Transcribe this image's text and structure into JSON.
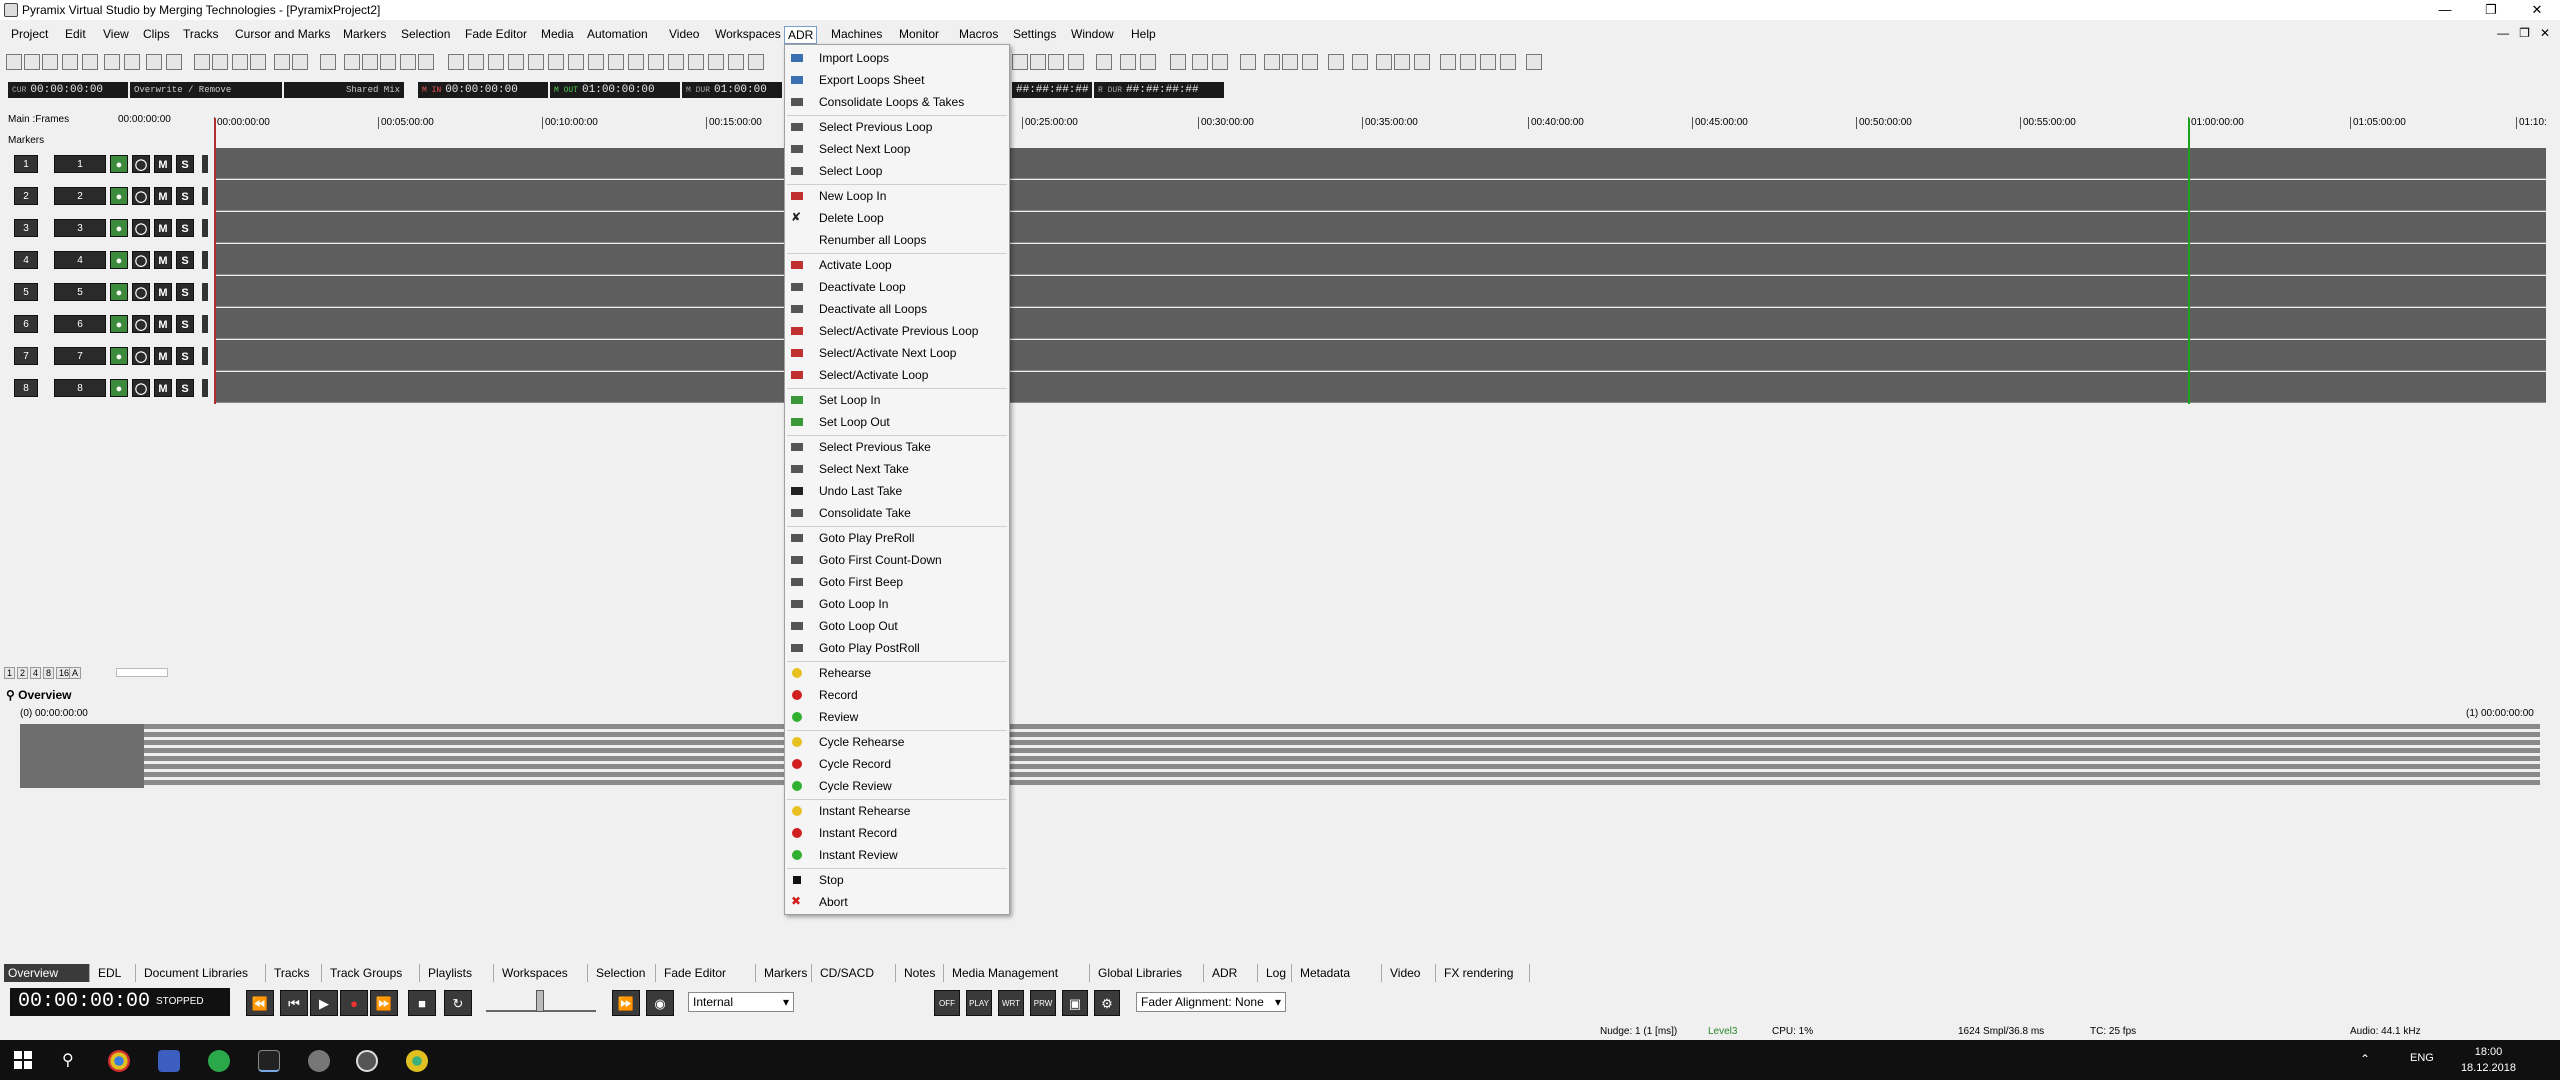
{
  "app": {
    "title": "Pyramix Virtual Studio by Merging Technologies - [PyramixProject2]"
  },
  "menubar": [
    "Project",
    "Edit",
    "View",
    "Clips",
    "Tracks",
    "Cursor and Marks",
    "Markers",
    "Selection",
    "Fade Editor",
    "Media",
    "Automation",
    "Video",
    "Workspaces",
    "ADR",
    "Machines",
    "Monitor",
    "Macros",
    "Settings",
    "Window",
    "Help"
  ],
  "active_menu": "ADR",
  "transport_row": {
    "cur_label": "CUR",
    "cur_value": "00:00:00:00",
    "mode": "Overwrite / Remove",
    "mix": "Shared Mix",
    "m_in_label": "M IN",
    "m_in": "00:00:00:00",
    "m_out_label": "M OUT",
    "m_out": "01:00:00:00",
    "m_dur_label": "M DUR",
    "m_dur": "01:00:00",
    "r_dur_label": "R DUR",
    "r_dur": "##:##:##:##",
    "r_hash": "##:##:##:##"
  },
  "timeline": {
    "main_label": "Main :Frames",
    "main_value": "00:00:00:00",
    "markers_label": "Markers",
    "ticks": [
      "00:00:00:00",
      "00:05:00:00",
      "00:10:00:00",
      "00:15:00:00",
      "00:25:00:00",
      "00:30:00:00",
      "00:35:00:00",
      "00:40:00:00",
      "00:45:00:00",
      "00:50:00:00",
      "00:55:00:00",
      "01:00:00:00",
      "01:05:00:00",
      "01:10:"
    ]
  },
  "tracks": [
    {
      "num": "1",
      "name": "1"
    },
    {
      "num": "2",
      "name": "2"
    },
    {
      "num": "3",
      "name": "3"
    },
    {
      "num": "4",
      "name": "4"
    },
    {
      "num": "5",
      "name": "5"
    },
    {
      "num": "6",
      "name": "6"
    },
    {
      "num": "7",
      "name": "7"
    },
    {
      "num": "8",
      "name": "8"
    }
  ],
  "track_buttons": {
    "mute": "M",
    "solo": "S"
  },
  "zoom_buttons": [
    "1",
    "2",
    "4",
    "8",
    "16",
    "A"
  ],
  "overview": {
    "title": "Overview",
    "start": "(0) 00:00:00:00",
    "end": "(1) 00:00:00:00"
  },
  "adr_menu": [
    {
      "label": "Import Loops",
      "icon": "import-icon",
      "color": "#3a6fb0"
    },
    {
      "label": "Export Loops Sheet",
      "icon": "export-icon",
      "color": "#3a6fb0"
    },
    {
      "label": "Consolidate Loops & Takes",
      "icon": "consolidate-icon",
      "color": "#555555"
    },
    "sep",
    {
      "label": "Select Previous Loop",
      "icon": "prev-loop-icon",
      "color": "#555555"
    },
    {
      "label": "Select Next Loop",
      "icon": "next-loop-icon",
      "color": "#555555"
    },
    {
      "label": "Select Loop",
      "icon": "select-loop-icon",
      "color": "#555555"
    },
    "sep",
    {
      "label": "New Loop In",
      "icon": "new-loop-icon",
      "color": "#c03030"
    },
    {
      "label": "Delete Loop",
      "icon": "delete-loop-icon",
      "color": "#222222"
    },
    {
      "label": "Renumber all Loops",
      "icon": "",
      "color": ""
    },
    "sep",
    {
      "label": "Activate Loop",
      "icon": "activate-loop-icon",
      "color": "#c03030"
    },
    {
      "label": "Deactivate Loop",
      "icon": "deactivate-loop-icon",
      "color": "#555555"
    },
    {
      "label": "Deactivate all Loops",
      "icon": "deactivate-all-icon",
      "color": "#555555"
    },
    {
      "label": "Select/Activate Previous Loop",
      "icon": "select-activate-prev-icon",
      "color": "#c03030"
    },
    {
      "label": "Select/Activate Next Loop",
      "icon": "select-activate-next-icon",
      "color": "#c03030"
    },
    {
      "label": "Select/Activate Loop",
      "icon": "select-activate-icon",
      "color": "#c03030"
    },
    "sep",
    {
      "label": "Set Loop In",
      "icon": "set-loop-in-icon",
      "color": "#3a9a3a"
    },
    {
      "label": "Set Loop Out",
      "icon": "set-loop-out-icon",
      "color": "#3a9a3a"
    },
    "sep",
    {
      "label": "Select Previous Take",
      "icon": "prev-take-icon",
      "color": "#555555"
    },
    {
      "label": "Select Next Take",
      "icon": "next-take-icon",
      "color": "#555555"
    },
    {
      "label": "Undo Last Take",
      "icon": "undo-take-icon",
      "color": "#222222"
    },
    {
      "label": "Consolidate Take",
      "icon": "consolidate-take-icon",
      "color": "#555555"
    },
    "sep",
    {
      "label": "Goto Play PreRoll",
      "icon": "goto-preroll-icon",
      "color": "#555555"
    },
    {
      "label": "Goto First Count-Down",
      "icon": "goto-countdown-icon",
      "color": "#555555"
    },
    {
      "label": "Goto First Beep",
      "icon": "goto-beep-icon",
      "color": "#555555"
    },
    {
      "label": "Goto Loop In",
      "icon": "goto-loop-in-icon",
      "color": "#555555"
    },
    {
      "label": "Goto Loop Out",
      "icon": "goto-loop-out-icon",
      "color": "#555555"
    },
    {
      "label": "Goto Play PostRoll",
      "icon": "goto-postroll-icon",
      "color": "#555555"
    },
    "sep",
    {
      "label": "Rehearse",
      "icon": "rehearse-icon",
      "color": "#e8c020"
    },
    {
      "label": "Record",
      "icon": "record-icon",
      "color": "#d02020"
    },
    {
      "label": "Review",
      "icon": "review-icon",
      "color": "#30b030"
    },
    "sep",
    {
      "label": "Cycle Rehearse",
      "icon": "cycle-rehearse-icon",
      "color": "#e8c020"
    },
    {
      "label": "Cycle Record",
      "icon": "cycle-record-icon",
      "color": "#d02020"
    },
    {
      "label": "Cycle Review",
      "icon": "cycle-review-icon",
      "color": "#30b030"
    },
    "sep",
    {
      "label": "Instant Rehearse",
      "icon": "instant-rehearse-icon",
      "color": "#e8c020"
    },
    {
      "label": "Instant Record",
      "icon": "instant-record-icon",
      "color": "#d02020"
    },
    {
      "label": "Instant Review",
      "icon": "instant-review-icon",
      "color": "#30b030"
    },
    "sep",
    {
      "label": "Stop",
      "icon": "stop-icon",
      "color": "#111111"
    },
    {
      "label": "Abort",
      "icon": "abort-icon",
      "color": "#d02020"
    }
  ],
  "bottom_tabs": [
    "Overview",
    "EDL",
    "Document Libraries",
    "Tracks",
    "Track Groups",
    "Playlists",
    "Workspaces",
    "Selection",
    "Fade Editor",
    "Markers",
    "CD/SACD",
    "Notes",
    "Media Management",
    "Global Libraries",
    "ADR",
    "Log",
    "Metadata",
    "Video",
    "FX rendering"
  ],
  "transport": {
    "timecode": "00:00:00:00",
    "status": "STOPPED",
    "sync": "Internal",
    "fader_alignment": "Fader Alignment: None",
    "mode_buttons": [
      "OFF",
      "PLAY",
      "WRT",
      "PRW"
    ]
  },
  "statusbar": {
    "nudge": "Nudge: 1 (1 [ms])",
    "level": "Level3",
    "cpu": "CPU: 1%",
    "buffer": "1624 Smpl/36.8 ms",
    "tc": "TC: 25 fps",
    "audio": "Audio: 44.1 kHz"
  },
  "taskbar": {
    "lang": "ENG",
    "time": "18:00",
    "date": "18.12.2018"
  },
  "colors": {
    "lane": "#5e5e5e",
    "playhead": "#b03030",
    "end_marker": "#19a519"
  }
}
